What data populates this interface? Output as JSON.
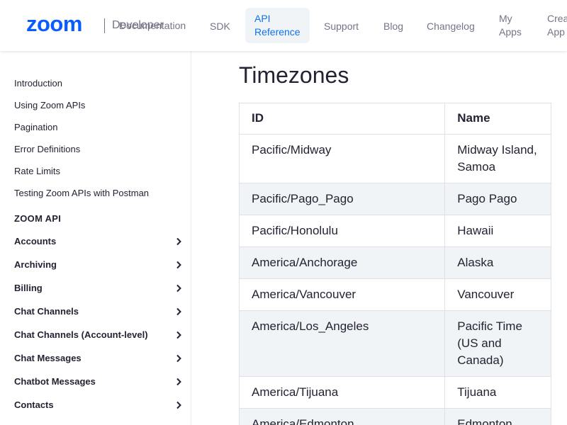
{
  "header": {
    "brand_text": "Developer",
    "nav_overlap": "Documentation",
    "nav": {
      "sdk": "SDK",
      "api_reference_1": "API",
      "api_reference_2": "Reference",
      "support": "Support",
      "blog": "Blog",
      "changelog": "Changelog",
      "my_apps_1": "My",
      "my_apps_2": "Apps",
      "create_app_1": "Crea",
      "create_app_2": "App"
    },
    "colors": {
      "brand": "#0b5cff",
      "active": "#0e72ed"
    }
  },
  "sidebar": {
    "links": [
      "Introduction",
      "Using Zoom APIs",
      "Pagination",
      "Error Definitions",
      "Rate Limits",
      "Testing Zoom APIs with Postman"
    ],
    "heading": "ZOOM API",
    "groups": [
      "Accounts",
      "Archiving",
      "Billing",
      "Chat Channels",
      "Chat Channels (Account-level)",
      "Chat Messages",
      "Chatbot Messages",
      "Contacts"
    ],
    "group_icon": "chevron-right-icon"
  },
  "main": {
    "title": "Timezones",
    "table": {
      "headers": [
        "ID",
        "Name"
      ],
      "rows": [
        {
          "id": "Pacific/Midway",
          "name": "Midway Island, Samoa"
        },
        {
          "id": "Pacific/Pago_Pago",
          "name": "Pago Pago"
        },
        {
          "id": "Pacific/Honolulu",
          "name": "Hawaii"
        },
        {
          "id": "America/Anchorage",
          "name": "Alaska"
        },
        {
          "id": "America/Vancouver",
          "name": "Vancouver"
        },
        {
          "id": "America/Los_Angeles",
          "name": "Pacific Time (US and Canada)"
        },
        {
          "id": "America/Tijuana",
          "name": "Tijuana"
        },
        {
          "id": "America/Edmonton",
          "name": "Edmonton"
        }
      ]
    }
  }
}
